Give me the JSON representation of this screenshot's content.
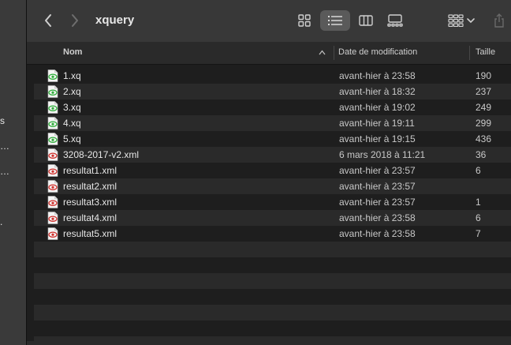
{
  "sidebar": {
    "fragments": [
      {
        "text": "s"
      },
      {
        "text": "…"
      },
      {
        "text": "…"
      },
      {
        "text": "."
      }
    ]
  },
  "toolbar": {
    "title": "xquery",
    "buttons": [
      {
        "name": "back-button",
        "icon": "chevron-left-icon"
      },
      {
        "name": "forward-button",
        "icon": "chevron-right-icon"
      },
      {
        "name": "view-icons-button",
        "icon": "grid-icon"
      },
      {
        "name": "view-list-button",
        "icon": "list-icon",
        "active": true
      },
      {
        "name": "view-columns-button",
        "icon": "columns-icon"
      },
      {
        "name": "view-gallery-button",
        "icon": "gallery-icon"
      },
      {
        "name": "group-button",
        "icon": "group-grid-icon"
      },
      {
        "name": "share-button",
        "icon": "share-icon"
      }
    ]
  },
  "header": {
    "name": "Nom",
    "date": "Date de modification",
    "size": "Taille"
  },
  "files": [
    {
      "name": "1.xq",
      "date": "avant-hier à 23:58",
      "size": "190",
      "kind": "xq"
    },
    {
      "name": "2.xq",
      "date": "avant-hier à 18:32",
      "size": "237",
      "kind": "xq"
    },
    {
      "name": "3.xq",
      "date": "avant-hier à 19:02",
      "size": "249",
      "kind": "xq"
    },
    {
      "name": "4.xq",
      "date": "avant-hier à 19:11",
      "size": "299",
      "kind": "xq"
    },
    {
      "name": "5.xq",
      "date": "avant-hier à 19:15",
      "size": "436",
      "kind": "xq"
    },
    {
      "name": "3208-2017-v2.xml",
      "date": "6 mars 2018 à 11:21",
      "size": "36",
      "kind": "xml"
    },
    {
      "name": "resultat1.xml",
      "date": "avant-hier à 23:57",
      "size": "6",
      "kind": "xml"
    },
    {
      "name": "resultat2.xml",
      "date": "avant-hier à 23:57",
      "size": "",
      "kind": "xml"
    },
    {
      "name": "resultat3.xml",
      "date": "avant-hier à 23:57",
      "size": "1",
      "kind": "xml"
    },
    {
      "name": "resultat4.xml",
      "date": "avant-hier à 23:58",
      "size": "6",
      "kind": "xml"
    },
    {
      "name": "resultat5.xml",
      "date": "avant-hier à 23:58",
      "size": "7",
      "kind": "xml"
    }
  ],
  "colors": {
    "xq_accent": "#2fae3a",
    "xml_accent": "#d0312d"
  }
}
